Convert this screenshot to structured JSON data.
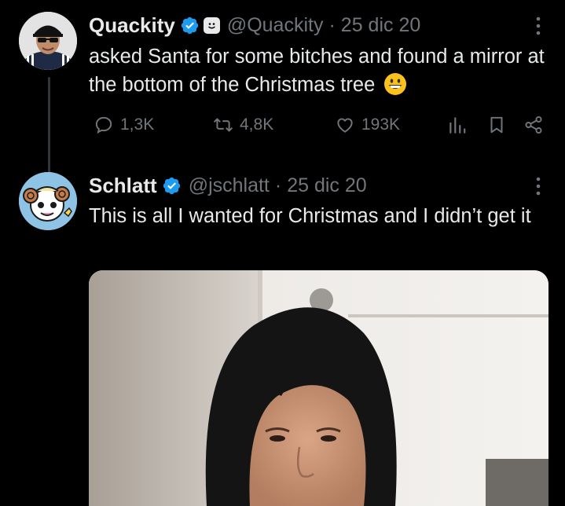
{
  "tweets": [
    {
      "name": "Quackity",
      "handle": "@Quackity",
      "separator": "·",
      "date": "25 dic 20",
      "text": "asked Santa for some bitches and found a mirror at the bottom of the Christmas tree",
      "emoji": "grinning-face-emoji",
      "badges": [
        "verified-badge",
        "affiliate-badge"
      ],
      "stats": {
        "replies": "1,3K",
        "retweets": "4,8K",
        "likes": "193K"
      }
    },
    {
      "name": "Schlatt",
      "handle": "@jschlatt",
      "separator": "·",
      "date": "25 dic 20",
      "text": "This is all I wanted for Christmas and I didn’t get it",
      "badges": [
        "verified-badge"
      ],
      "media": "photo-person-black-hair"
    }
  ],
  "colors": {
    "background": "#000000",
    "text": "#e7e9ea",
    "secondary": "#71767b",
    "verified": "#1d9bf0",
    "thread_line": "#333639"
  },
  "icons": [
    "reply-icon",
    "retweet-icon",
    "like-icon",
    "views-icon",
    "bookmark-icon",
    "share-icon",
    "more-icon",
    "verified-icon"
  ]
}
